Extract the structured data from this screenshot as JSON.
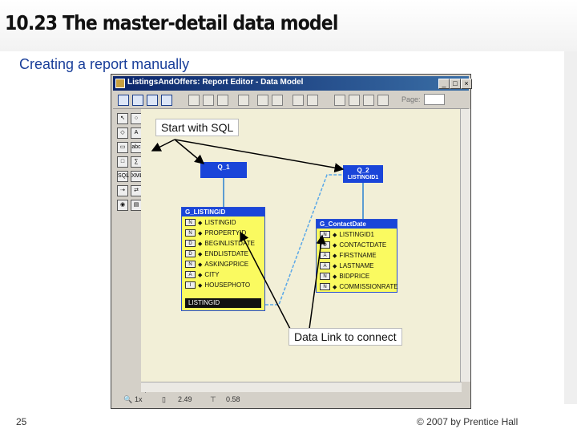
{
  "slide": {
    "title": "10.23 The master-detail data model",
    "subtitle": "Creating a report manually",
    "page_number": "25",
    "copyright": "© 2007 by Prentice Hall"
  },
  "window": {
    "title": "ListingsAndOffers: Report Editor - Data Model",
    "controls": {
      "minimize": "_",
      "maximize": "□",
      "close": "×"
    },
    "toolbar": {
      "page_label": "Page:"
    }
  },
  "palette": {
    "items": [
      "A",
      "abc",
      "SQL",
      "XML"
    ]
  },
  "callouts": {
    "sql": "Start with SQL",
    "link": "Data Link to connect"
  },
  "queries": {
    "q1": {
      "label": "Q_1"
    },
    "q2": {
      "label": "Q_2",
      "sub": "LISTINGID1"
    }
  },
  "group1": {
    "header": "G_LISTINGID",
    "rows": [
      "LISTINGID",
      "PROPERTYID",
      "BEGINLISTDATE",
      "ENDLISTDATE",
      "ASKINGPRICE",
      "CITY",
      "HOUSEPHOTO"
    ],
    "footer": "LISTINGID"
  },
  "group2": {
    "header": "G_ContactDate",
    "rows": [
      "LISTINGID1",
      "CONTACTDATE",
      "FIRSTNAME",
      "LASTNAME",
      "BIDPRICE",
      "COMMISSIONRATE"
    ]
  },
  "status": {
    "zoom": "1x",
    "x_coord": "2.49",
    "y_coord": "0.58"
  }
}
